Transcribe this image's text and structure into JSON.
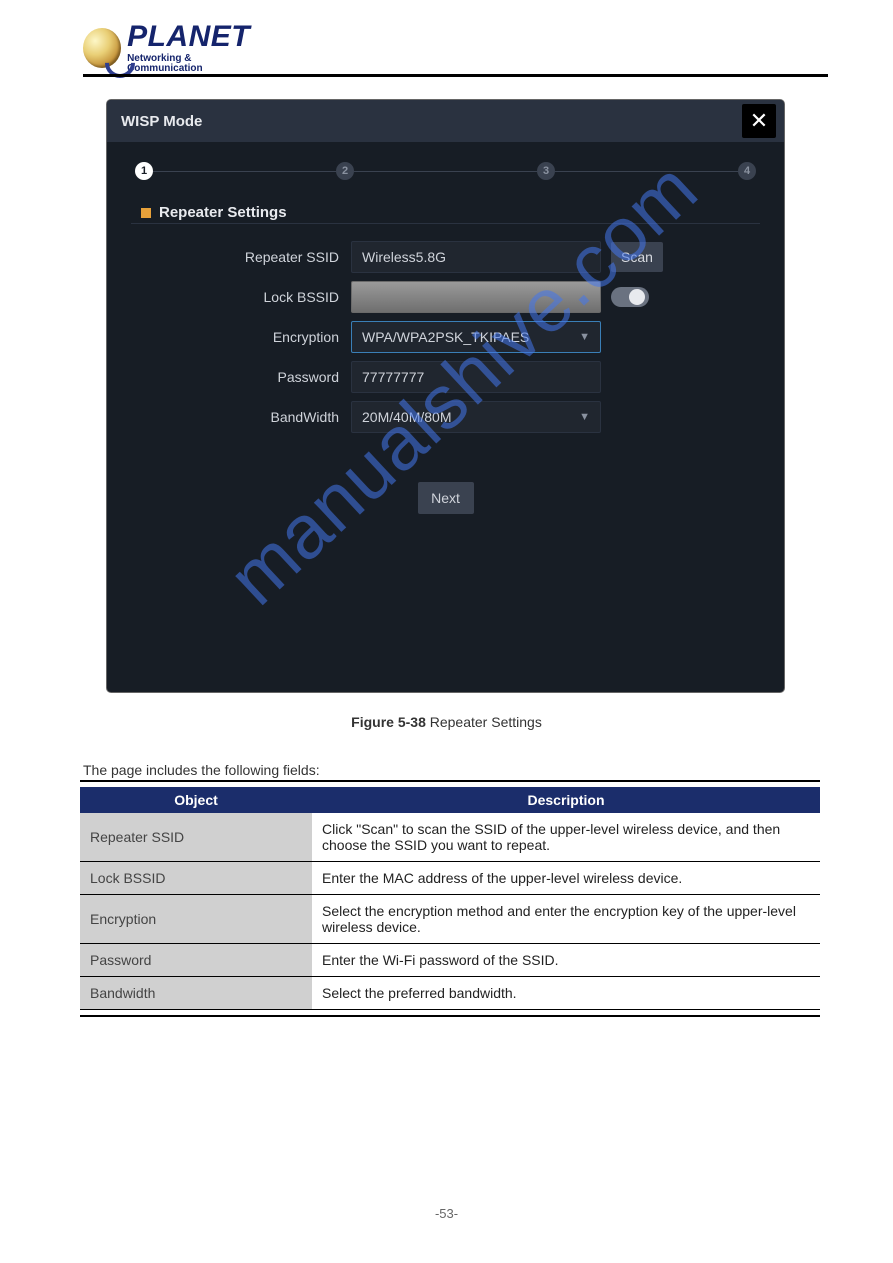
{
  "brand": {
    "name": "PLANET",
    "tag": "Networking & Communication"
  },
  "modal": {
    "title": "WISP Mode",
    "close_glyph": "✕",
    "steps": [
      "1",
      "2",
      "3",
      "4"
    ],
    "section_title": "Repeater Settings",
    "labels": {
      "ssid": "Repeater SSID",
      "bssid": "Lock BSSID",
      "encryption": "Encryption",
      "password": "Password",
      "bandwidth": "BandWidth"
    },
    "values": {
      "ssid": "Wireless5.8G",
      "bssid": "",
      "encryption": "WPA/WPA2PSK_TKIPAES",
      "password": "77777777",
      "bandwidth": "20M/40M/80M"
    },
    "buttons": {
      "scan": "Scan",
      "next": "Next"
    }
  },
  "watermark": "manualshive.com",
  "caption": {
    "prefix": "Figure 5-",
    "num": "38",
    "rest": " Repeater Settings"
  },
  "subcaption": "The page includes the following fields:",
  "table": {
    "head": [
      "Object",
      "Description"
    ],
    "rows": [
      [
        "Repeater SSID",
        "Click \"Scan\" to scan the SSID of the upper-level wireless device, and then choose the SSID you want to repeat."
      ],
      [
        "Lock BSSID",
        "Enter the MAC address of the upper-level wireless device."
      ],
      [
        "Encryption",
        "Select the encryption method and enter the encryption key of the upper-level wireless device."
      ],
      [
        "Password",
        "Enter the Wi-Fi password of the SSID."
      ],
      [
        "Bandwidth",
        "Select the preferred bandwidth."
      ]
    ]
  },
  "page_number": "-53-"
}
